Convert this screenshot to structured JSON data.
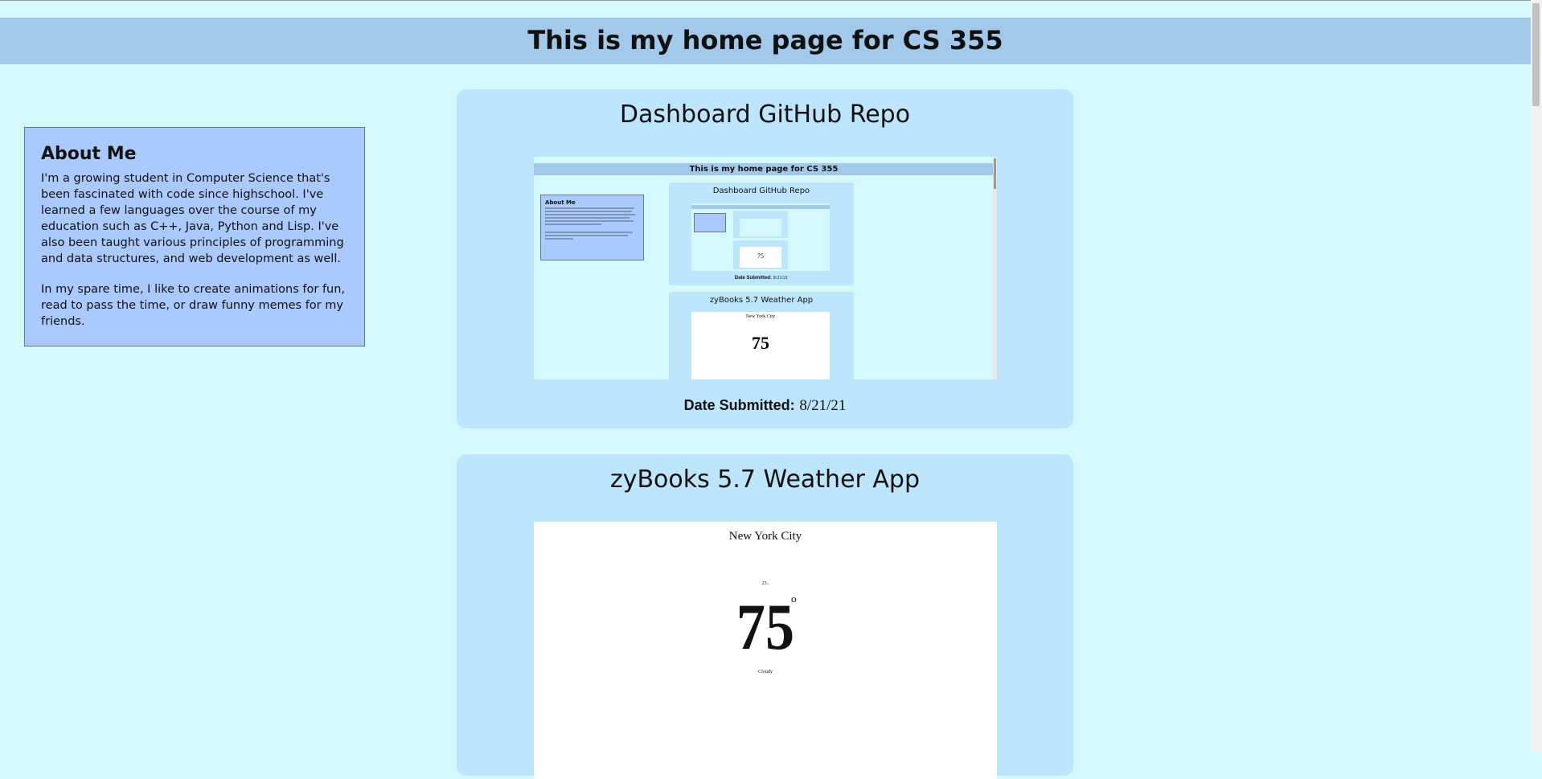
{
  "page": {
    "title": "This is my home page for CS 355"
  },
  "about": {
    "heading": "About Me",
    "paragraph1": "I'm a growing student in Computer Science that's been fascinated with code since highschool. I've learned a few languages over the course of my education such as C++, Java, Python and Lisp. I've also been taught various principles of programming and data structures, and web development as well.",
    "paragraph2": "In my spare time, I like to create animations for fun, read to pass the time, or draw funny memes for my friends."
  },
  "projects": [
    {
      "title": "Dashboard GitHub Repo",
      "date_label": "Date Submitted:",
      "date_value": "8/21/21",
      "preview": {
        "header": "This is my home page for CS 355",
        "about_heading": "About Me",
        "card1_title": "Dashboard GitHub Repo",
        "card1_date_label": "Date Submitted:",
        "card1_date_value": "8/21/21",
        "card2_title": "zyBooks 5.7 Weather App",
        "card2_city": "New York City",
        "card2_temp": "75",
        "micro_temp": "75"
      }
    },
    {
      "title": "zyBooks 5.7 Weather App",
      "preview": {
        "city": "New York City",
        "top_label": "23..",
        "temperature": "75",
        "degree_symbol": "o",
        "condition": "Cloudy"
      }
    }
  ]
}
